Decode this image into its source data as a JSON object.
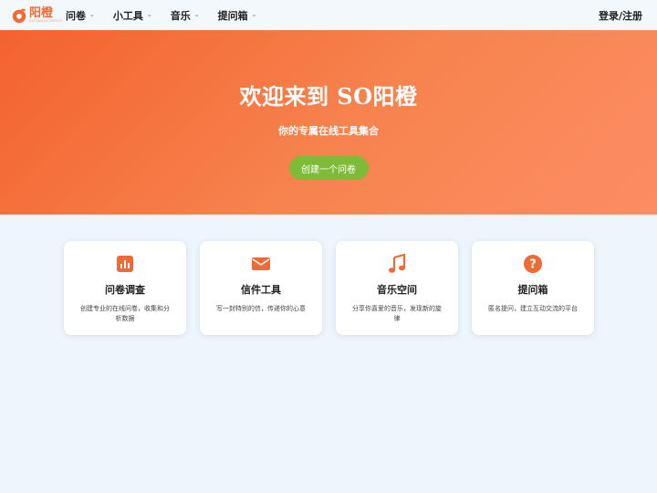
{
  "brand": {
    "name": "阳橙",
    "tagline": "SOYANGCHENG",
    "accent": "#f06a35"
  },
  "nav": {
    "items": [
      {
        "label": "问卷"
      },
      {
        "label": "小工具"
      },
      {
        "label": "音乐"
      },
      {
        "label": "提问箱"
      }
    ],
    "login_label": "登录/注册"
  },
  "hero": {
    "title": "欢迎来到 SO阳橙",
    "subtitle": "你的专属在线工具集合",
    "cta_label": "创建一个问卷",
    "cta_color": "#7dbb38"
  },
  "cards": [
    {
      "icon": "bar-chart-icon",
      "title": "问卷调查",
      "desc": "创建专业的在线问卷，收集和分析数据"
    },
    {
      "icon": "envelope-icon",
      "title": "信件工具",
      "desc": "写一封特别的信，传递你的心意"
    },
    {
      "icon": "music-note-icon",
      "title": "音乐空间",
      "desc": "分享你喜爱的音乐，发现新的旋律"
    },
    {
      "icon": "question-circle-icon",
      "title": "提问箱",
      "desc": "匿名提问，建立互动交流的平台"
    }
  ]
}
